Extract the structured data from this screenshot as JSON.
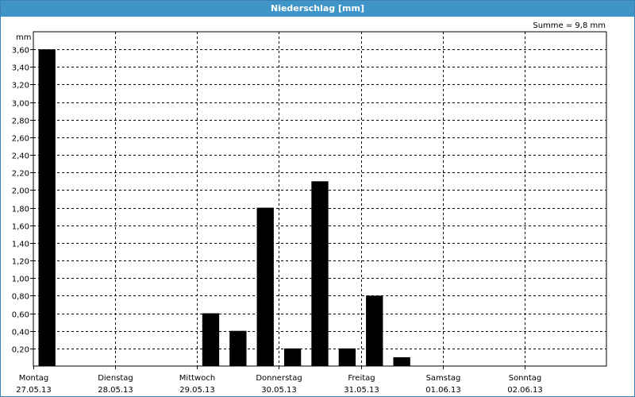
{
  "window": {
    "title": "Niederschlag [mm]",
    "summary": "Summe = 9,8 mm"
  },
  "chart_data": {
    "type": "bar",
    "title": "Niederschlag [mm]",
    "ylabel": "mm",
    "ylim": [
      0,
      3.8
    ],
    "grid": true,
    "y_ticks": [
      "0,20",
      "0,40",
      "0,60",
      "0,80",
      "1,00",
      "1,20",
      "1,40",
      "1,60",
      "1,80",
      "2,00",
      "2,20",
      "2,40",
      "2,60",
      "2,80",
      "3,00",
      "3,20",
      "3,40",
      "3,60"
    ],
    "y_tick_values": [
      0.2,
      0.4,
      0.6,
      0.8,
      1.0,
      1.2,
      1.4,
      1.6,
      1.8,
      2.0,
      2.2,
      2.4,
      2.6,
      2.8,
      3.0,
      3.2,
      3.4,
      3.6
    ],
    "day_labels": [
      {
        "day": "Montag",
        "date": "27.05.13"
      },
      {
        "day": "Dienstag",
        "date": "28.05.13"
      },
      {
        "day": "Mittwoch",
        "date": "29.05.13"
      },
      {
        "day": "Donnerstag",
        "date": "30.05.13"
      },
      {
        "day": "Freitag",
        "date": "31.05.13"
      },
      {
        "day": "Samstag",
        "date": "01.06.13"
      },
      {
        "day": "Sonntag",
        "date": "02.06.13"
      }
    ],
    "bars_per_day": 3,
    "values": [
      3.6,
      0,
      0,
      0,
      0,
      0,
      0.6,
      0.4,
      1.8,
      0.2,
      2.1,
      0.2,
      0.8,
      0.1,
      0,
      0,
      0,
      0,
      0,
      0,
      0
    ],
    "bar_color": "#000000",
    "grid_color": "#000000"
  }
}
